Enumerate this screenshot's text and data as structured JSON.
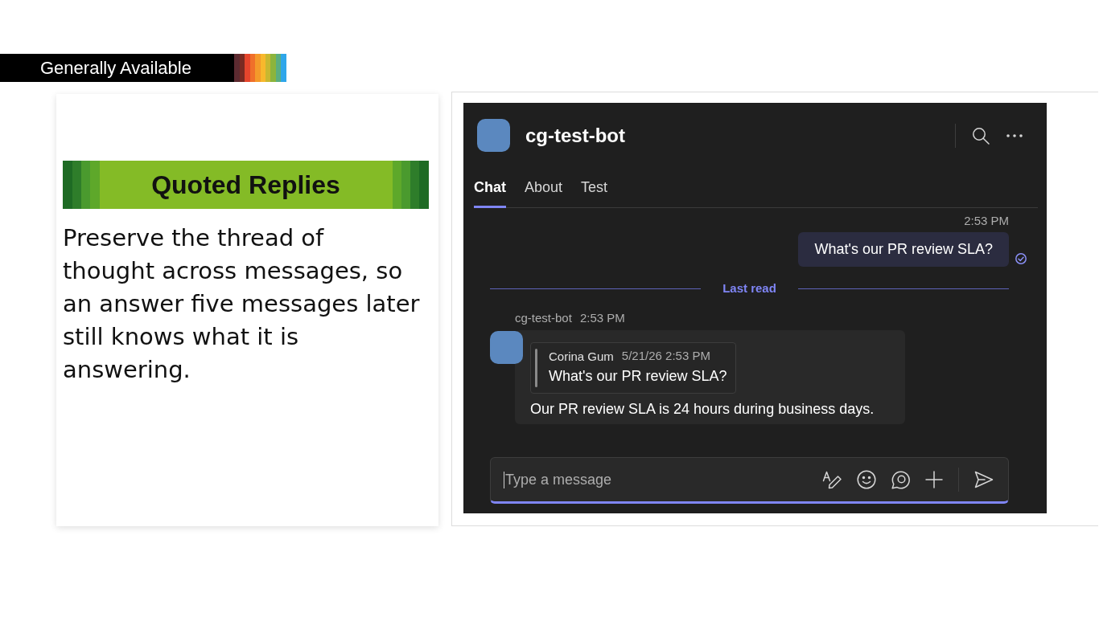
{
  "release_label": {
    "text": "Generally Available"
  },
  "feature_card": {
    "title": "Quoted Replies",
    "description": "Preserve the thread of thought across messages, so an answer five messages later still knows what it is answering."
  },
  "chat_window": {
    "title": "cg-test-bot",
    "tabs": [
      {
        "label": "Chat",
        "selected": true
      },
      {
        "label": "About",
        "selected": false
      },
      {
        "label": "Test",
        "selected": false
      }
    ],
    "messages": [
      {
        "kind": "sent",
        "time": "2:53 PM",
        "text": "What's our PR review SLA?",
        "read": true
      },
      {
        "kind": "divider",
        "label": "Last read"
      },
      {
        "kind": "received",
        "sender": "cg-test-bot",
        "time": "2:53 PM",
        "quote": {
          "author": "Corina Gum",
          "time": "5/21/26 2:53 PM",
          "text": "What's our PR review SLA?"
        },
        "text": "Our PR review SLA is 24 hours during business days."
      }
    ],
    "composer": {
      "placeholder": "Type a message"
    }
  }
}
